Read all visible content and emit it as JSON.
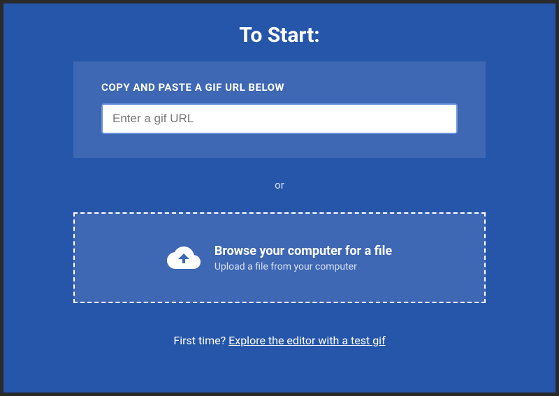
{
  "title": "To Start:",
  "urlPanel": {
    "label": "COPY AND PASTE A GIF URL BELOW",
    "placeholder": "Enter a gif URL",
    "value": ""
  },
  "separator": "or",
  "browsePanel": {
    "title": "Browse your computer for a file",
    "subtitle": "Upload a file from your computer"
  },
  "footer": {
    "prefix": "First time? ",
    "link": "Explore the editor with a test gif"
  },
  "icons": {
    "cloudUpload": "cloud-upload-icon"
  }
}
